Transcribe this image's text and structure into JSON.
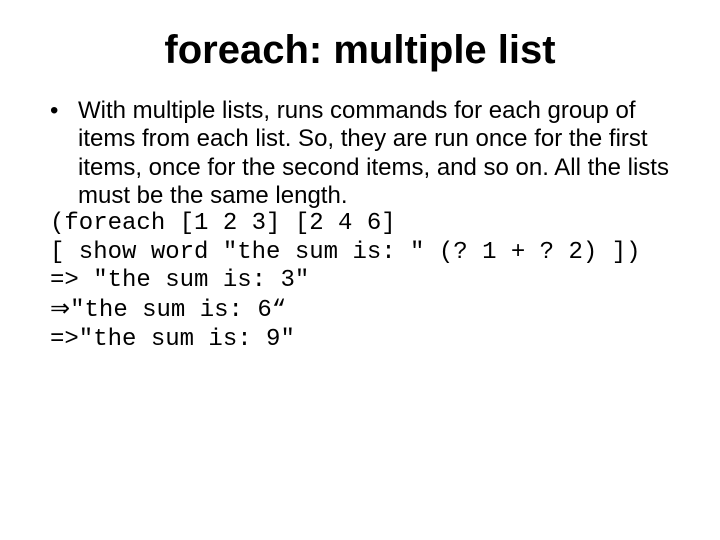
{
  "title": "foreach: multiple list",
  "bullet": "With multiple lists, runs commands for each group of items from each list. So, they are run once for the first items, once for the second items, and so on. All the lists must be the same length.",
  "code": {
    "line1": "(foreach [1 2 3] [2 4 6]",
    "line2": "[ show word \"the sum is: \" (? 1 + ? 2) ])",
    "out1": "=> \"the sum is: 3\"",
    "out2_arrow": "⇒",
    "out2_text": "\"the sum is: 6“",
    "out3": "=>\"the sum is: 9\""
  }
}
